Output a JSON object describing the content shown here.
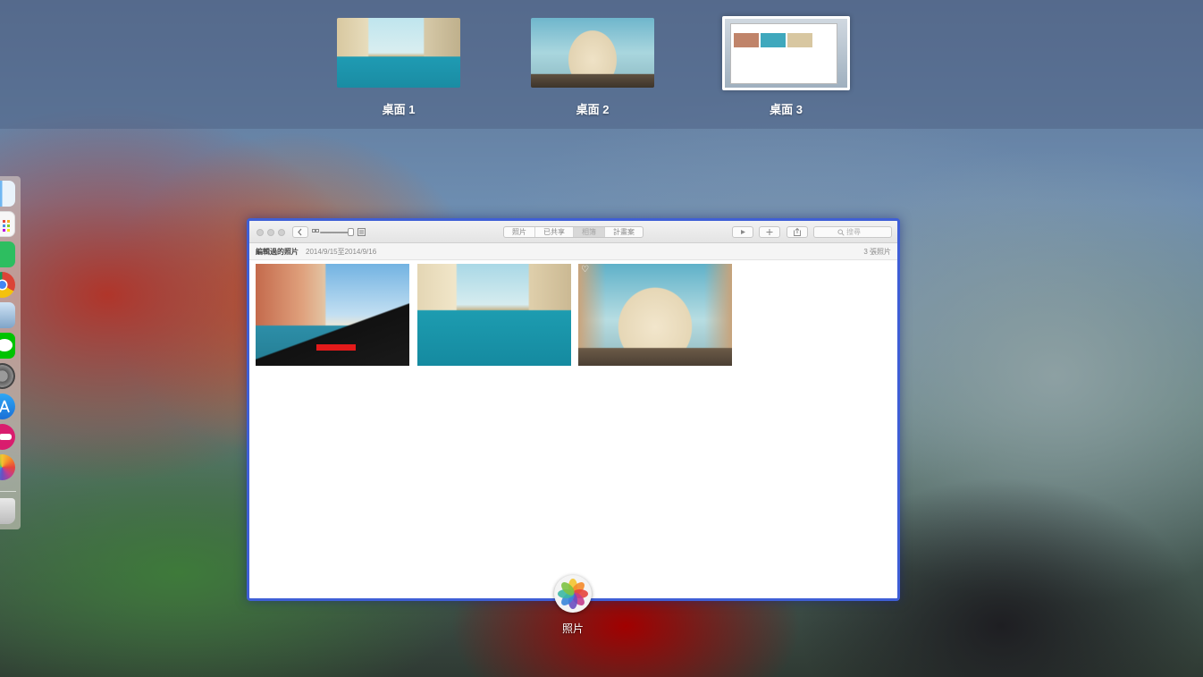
{
  "spaces": [
    {
      "label": "桌面 1"
    },
    {
      "label": "桌面 2"
    },
    {
      "label": "桌面 3"
    }
  ],
  "dock": {
    "items": [
      "finder-icon",
      "launchpad-icon",
      "evernote-icon",
      "chrome-icon",
      "preview-icon",
      "line-icon",
      "system-preferences-icon",
      "app-store-icon",
      "parcel-icon",
      "photos-icon",
      "trash-icon"
    ]
  },
  "window": {
    "tabs": [
      "照片",
      "已共享",
      "相簿",
      "計畫案"
    ],
    "selected_tab": "相簿",
    "search_placeholder": "搜尋",
    "header": {
      "title": "編輯過的照片",
      "date_range": "2014/9/15至2014/9/16",
      "count": "3 張照片"
    },
    "photos": [
      {
        "name": "gondola-venice"
      },
      {
        "name": "grand-canal-venice"
      },
      {
        "name": "milan-duomo",
        "favorite": true
      }
    ]
  },
  "app_switch": {
    "label": "照片"
  },
  "colors": {
    "window_highlight": "#3f5fd6",
    "photos_icon_colors": [
      "#f4c430",
      "#f58b2a",
      "#e6453c",
      "#c43d8d",
      "#6a4fc1",
      "#3a86d9",
      "#3bb8a4",
      "#7dc242"
    ]
  }
}
